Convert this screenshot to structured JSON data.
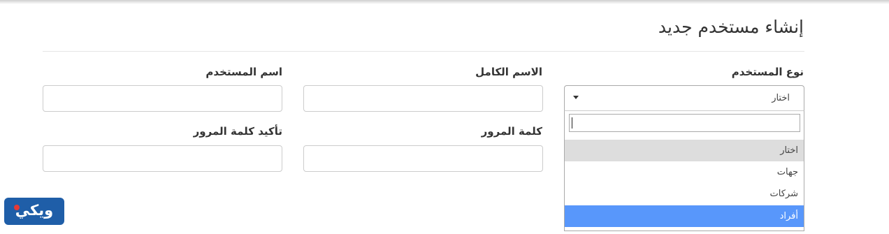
{
  "page": {
    "title": "إنشاء مستخدم جديد"
  },
  "form": {
    "user_type_label": "نوع المستخدم",
    "full_name_label": "الاسم الكامل",
    "username_label": "اسم المستخدم",
    "password_label": "كلمة المرور",
    "confirm_password_label": "تأكيد كلمة المرور",
    "full_name_value": "",
    "username_value": "",
    "password_value": "",
    "confirm_password_value": ""
  },
  "user_type_select": {
    "selected_value": "اختار",
    "search_value": "",
    "options": [
      "اختار",
      "جهات",
      "شركات",
      "أفراد"
    ],
    "selected_option": "اختار",
    "highlighted_option": "أفراد"
  },
  "logo": {
    "text": "ويكي"
  },
  "colors": {
    "highlight": "#5897fb",
    "selected_option_bg": "#dddddd",
    "logo_bg": "#1f5ea8"
  }
}
